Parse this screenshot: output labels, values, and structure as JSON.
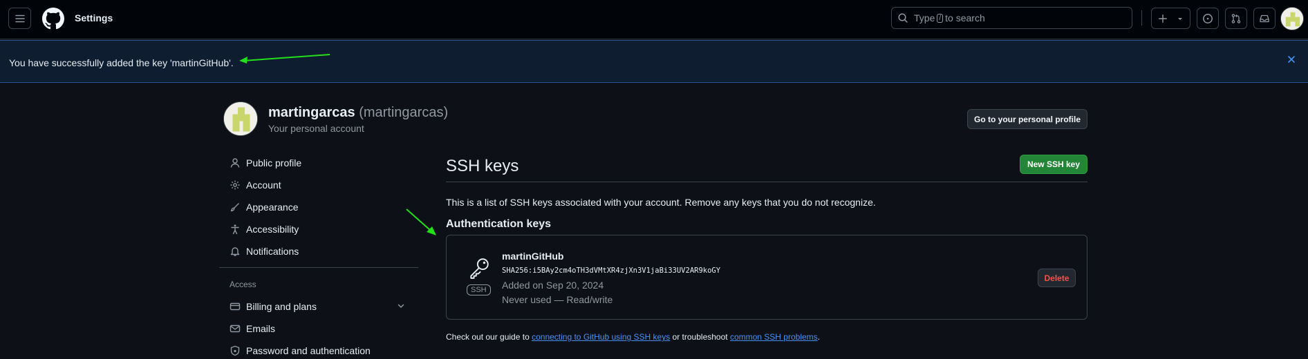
{
  "header": {
    "title": "Settings",
    "search_prefix": "Type",
    "search_key": "/",
    "search_suffix": "to search"
  },
  "flash": {
    "message": "You have successfully added the key 'martinGitHub'."
  },
  "profile": {
    "name": "martingarcas",
    "login": "(martingarcas)",
    "subtitle": "Your personal account",
    "button": "Go to your personal profile"
  },
  "sidebar": {
    "items": [
      {
        "label": "Public profile",
        "icon": "person-icon"
      },
      {
        "label": "Account",
        "icon": "gear-icon"
      },
      {
        "label": "Appearance",
        "icon": "paintbrush-icon"
      },
      {
        "label": "Accessibility",
        "icon": "accessibility-icon"
      },
      {
        "label": "Notifications",
        "icon": "bell-icon"
      }
    ],
    "access_heading": "Access",
    "access_items": [
      {
        "label": "Billing and plans",
        "icon": "credit-card-icon"
      },
      {
        "label": "Emails",
        "icon": "mail-icon"
      },
      {
        "label": "Password and authentication",
        "icon": "shield-lock-icon"
      }
    ]
  },
  "main": {
    "title": "SSH keys",
    "new_button": "New SSH key",
    "description": "This is a list of SSH keys associated with your account. Remove any keys that you do not recognize.",
    "section_heading": "Authentication keys",
    "key": {
      "title": "martinGitHub",
      "fingerprint": "SHA256:i5BAy2cm4oTH3dVMtXR4zjXn3V1jaBi33UV2AR9koGY",
      "added": "Added on Sep 20, 2024",
      "usage": "Never used — Read/write",
      "type_label": "SSH",
      "delete_button": "Delete"
    },
    "footer": {
      "prefix": "Check out our guide to",
      "link1": "connecting to GitHub using SSH keys",
      "middle": "or troubleshoot",
      "link2": "common SSH problems",
      "suffix": "."
    }
  },
  "colors": {
    "background": "#0d1117",
    "header_bg": "#010409",
    "flash_bg": "#0e1d30",
    "primary_button": "#238636",
    "danger": "#f85149",
    "link": "#4493f8",
    "annotation_arrow": "#22e01a"
  }
}
